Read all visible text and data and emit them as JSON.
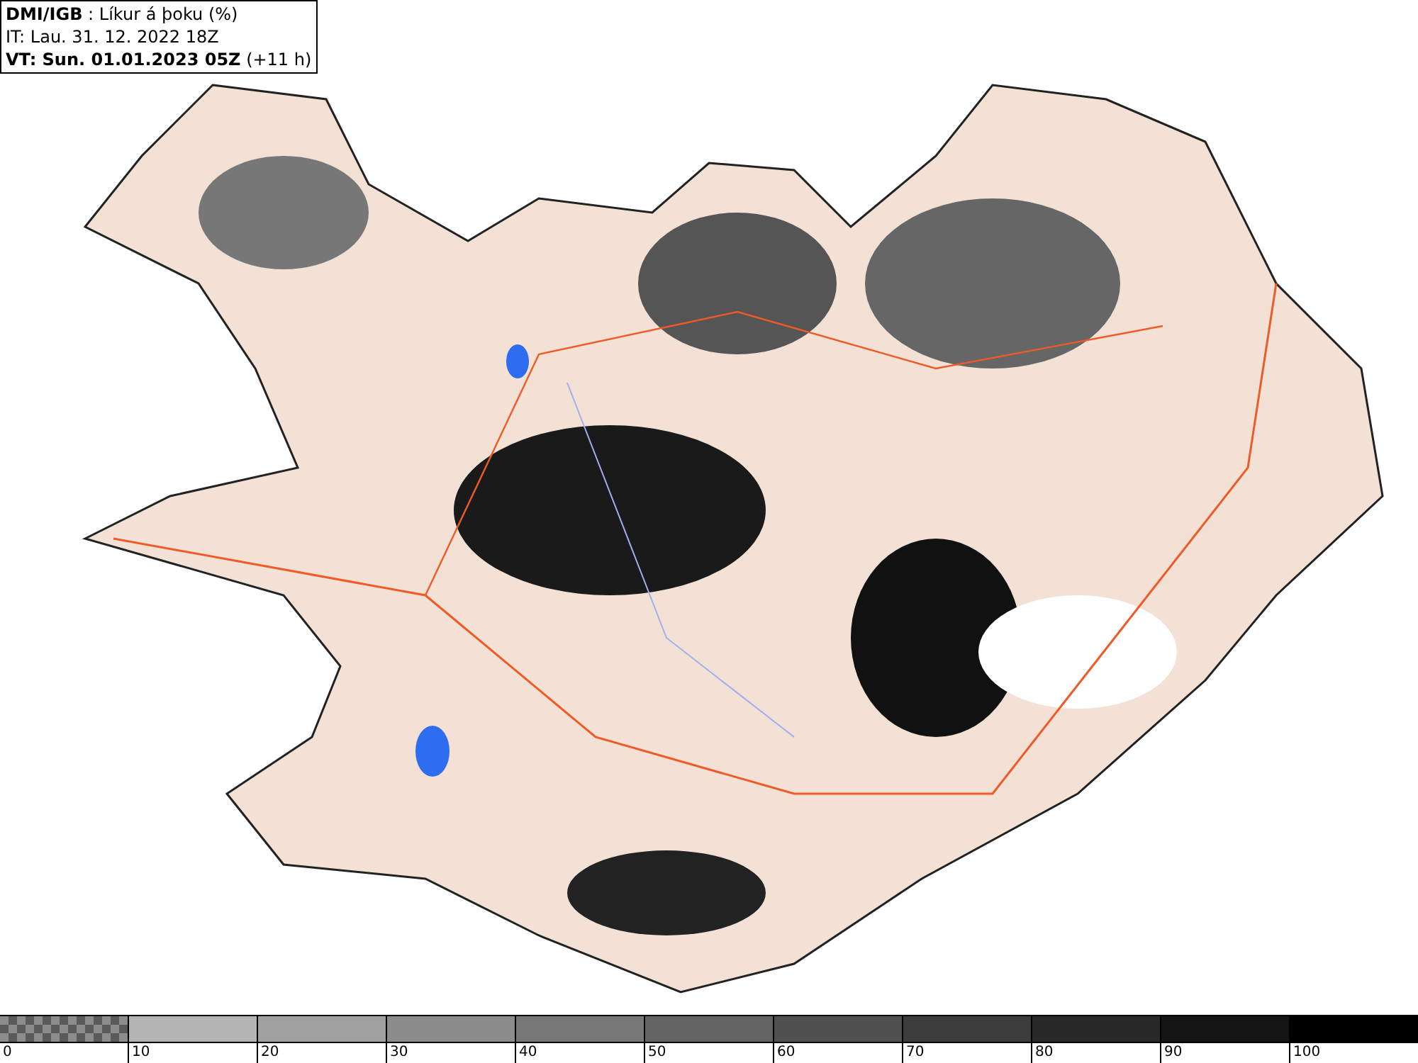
{
  "header": {
    "lines": [
      "**DMI/IGB** : Líkur á þoku (%)",
      "IT: Lau. 31. 12. 2022 18Z",
      "**VT: Sun. 01.01.2023 05Z** (+11 h)"
    ]
  },
  "legend": {
    "segments": [
      {
        "kind": "checker",
        "label": "0"
      },
      {
        "kind": "solid",
        "color": "#b4b4b4",
        "label": "10"
      },
      {
        "kind": "solid",
        "color": "#a0a0a0",
        "label": "20"
      },
      {
        "kind": "solid",
        "color": "#8c8c8c",
        "label": "30"
      },
      {
        "kind": "solid",
        "color": "#787878",
        "label": "40"
      },
      {
        "kind": "solid",
        "color": "#646464",
        "label": "50"
      },
      {
        "kind": "solid",
        "color": "#505050",
        "label": "60"
      },
      {
        "kind": "solid",
        "color": "#3c3c3c",
        "label": "70"
      },
      {
        "kind": "solid",
        "color": "#282828",
        "label": "80"
      },
      {
        "kind": "solid",
        "color": "#141414",
        "label": "90"
      },
      {
        "kind": "solid",
        "color": "#000000",
        "label": "100"
      }
    ]
  }
}
